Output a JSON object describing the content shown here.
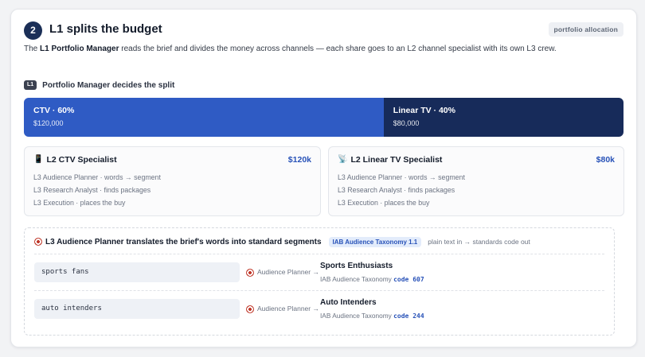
{
  "section": {
    "step_number": "2",
    "title": "L1 splits the budget",
    "tag": "portfolio allocation",
    "description_prefix": "The ",
    "description_bold": "L1 Portfolio Manager",
    "description_rest": " reads the brief and divides the money across channels — each share goes to an L2 channel specialist with its own L3 crew."
  },
  "split": {
    "badge": "L1",
    "heading": "Portfolio Manager decides the split",
    "segments": [
      {
        "label": "CTV · 60%",
        "amount": "$120,000",
        "share": 0.6,
        "color": "#2f5bc4"
      },
      {
        "label": "Linear TV · 40%",
        "amount": "$80,000",
        "share": 0.4,
        "color": "#172b5a"
      }
    ]
  },
  "specialists": [
    {
      "icon": "mobile-phone-icon",
      "icon_glyph": "📱",
      "name": "L2 CTV Specialist",
      "budget": "$120k",
      "crew": [
        "L3 Audience Planner · words → segment",
        "L3 Research Analyst · finds packages",
        "L3 Execution · places the buy"
      ]
    },
    {
      "icon": "satellite-antenna-icon",
      "icon_glyph": "📡",
      "name": "L2 Linear TV Specialist",
      "budget": "$80k",
      "crew": [
        "L3 Audience Planner · words → segment",
        "L3 Research Analyst · finds packages",
        "L3 Execution · places the buy"
      ]
    }
  ],
  "audience": {
    "icon": "dart-target-icon",
    "title": "L3 Audience Planner translates the brief's words into standard segments",
    "taxonomy_pill": "IAB Audience Taxonomy 1.1",
    "note": "plain text in → standards code out",
    "rows": [
      {
        "input": "sports fans",
        "agent": "Audience Planner →",
        "segment": "Sports Enthusiasts",
        "taxonomy": "IAB Audience Taxonomy",
        "code": "code 607"
      },
      {
        "input": "auto intenders",
        "agent": "Audience Planner →",
        "segment": "Auto Intenders",
        "taxonomy": "IAB Audience Taxonomy",
        "code": "code 244"
      }
    ]
  },
  "colors": {
    "accent": "#2852b8",
    "ctv_bar": "#2f5bc4",
    "linear_bar": "#172b5a",
    "step_badge": "#1b2f57"
  }
}
